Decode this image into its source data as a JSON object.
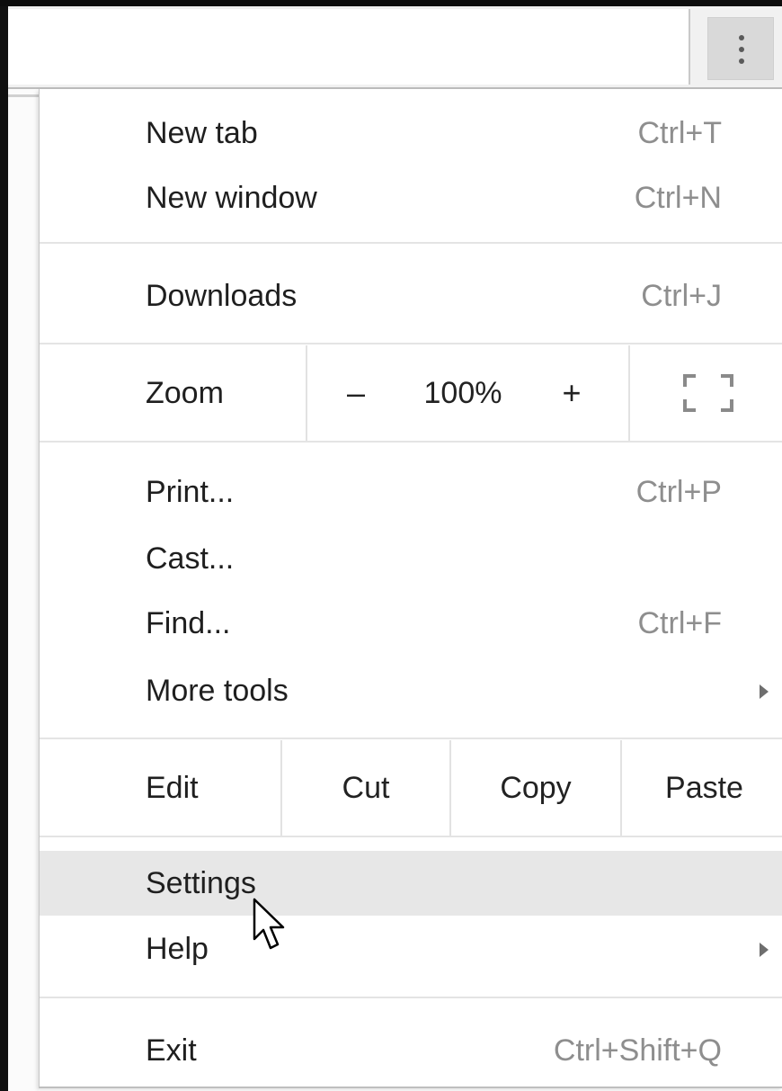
{
  "toolbar": {
    "menu_button_icon": "vertical-dots-icon"
  },
  "menu": {
    "new_tab": {
      "label": "New tab",
      "shortcut": "Ctrl+T"
    },
    "new_window": {
      "label": "New window",
      "shortcut": "Ctrl+N"
    },
    "downloads": {
      "label": "Downloads",
      "shortcut": "Ctrl+J"
    },
    "zoom": {
      "label": "Zoom",
      "minus": "–",
      "value": "100%",
      "plus": "+",
      "fullscreen_icon": "fullscreen-icon"
    },
    "print": {
      "label": "Print...",
      "shortcut": "Ctrl+P"
    },
    "cast": {
      "label": "Cast..."
    },
    "find": {
      "label": "Find...",
      "shortcut": "Ctrl+F"
    },
    "more_tools": {
      "label": "More tools",
      "submenu_icon": "submenu-arrow-icon"
    },
    "edit": {
      "label": "Edit",
      "cut": "Cut",
      "copy": "Copy",
      "paste": "Paste"
    },
    "settings": {
      "label": "Settings",
      "highlighted": true
    },
    "help": {
      "label": "Help",
      "submenu_icon": "submenu-arrow-icon"
    },
    "exit": {
      "label": "Exit",
      "shortcut": "Ctrl+Shift+Q"
    }
  },
  "colors": {
    "highlight": "#e7e7e7",
    "shortcut_text": "#8e8e8e",
    "label_text": "#1f1f1f"
  }
}
